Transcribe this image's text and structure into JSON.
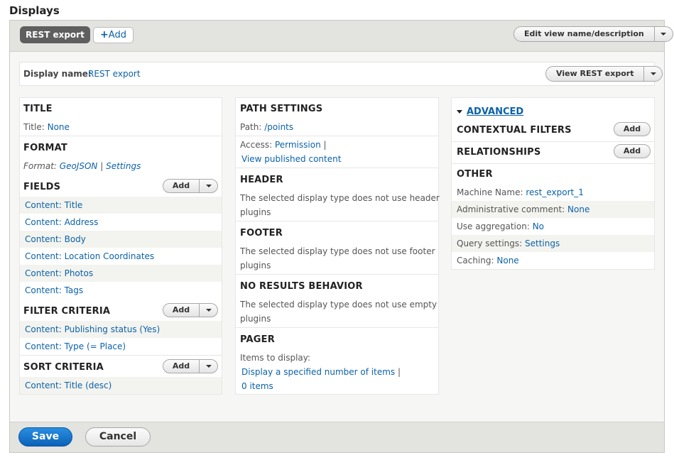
{
  "header": {
    "title": "Displays",
    "tab_rest": "REST export",
    "tab_add_plus": "+",
    "tab_add": "Add",
    "edit_view_button": "Edit view name/description"
  },
  "display": {
    "name_label": "Display name:",
    "name_value": "REST export",
    "view_button": "View REST export"
  },
  "left": {
    "title_head": "TITLE",
    "title_label": "Title:",
    "title_value": "None",
    "format_head": "FORMAT",
    "format_label": "Format:",
    "format_value": "GeoJSON",
    "format_sep": "|",
    "format_settings": "Settings",
    "fields_head": "FIELDS",
    "fields_add": "Add",
    "fields": [
      "Content: Title",
      "Content: Address",
      "Content: Body",
      "Content: Location Coordinates",
      "Content: Photos",
      "Content: Tags"
    ],
    "filter_head": "FILTER CRITERIA",
    "filter_add": "Add",
    "filters": [
      "Content: Publishing status (Yes)",
      "Content: Type (= Place)"
    ],
    "sort_head": "SORT CRITERIA",
    "sort_add": "Add",
    "sorts": [
      "Content: Title (desc)"
    ]
  },
  "middle": {
    "path_head": "PATH SETTINGS",
    "path_label": "Path:",
    "path_value": "/points",
    "access_label": "Access:",
    "access_value": "Permission",
    "access_sep": "|",
    "access_perm": "View published content",
    "header_head": "HEADER",
    "header_text_1": "The selected display type does not use header",
    "header_text_2": "plugins",
    "footer_head": "FOOTER",
    "footer_text_1": "The selected display type does not use footer",
    "footer_text_2": "plugins",
    "noresults_head": "NO RESULTS BEHAVIOR",
    "noresults_text_1": "The selected display type does not use empty",
    "noresults_text_2": "plugins",
    "pager_head": "PAGER",
    "pager_label": "Items to display:",
    "pager_value": "Display a specified number of items",
    "pager_sep": "|",
    "pager_items": "0 items"
  },
  "right": {
    "advanced": "ADVANCED",
    "contextual_head": "CONTEXTUAL FILTERS",
    "contextual_add": "Add",
    "relationships_head": "RELATIONSHIPS",
    "relationships_add": "Add",
    "other_head": "OTHER",
    "machine_label": "Machine Name:",
    "machine_value": "rest_export_1",
    "comment_label": "Administrative comment:",
    "comment_value": "None",
    "aggregation_label": "Use aggregation:",
    "aggregation_value": "No",
    "query_label": "Query settings:",
    "query_value": "Settings",
    "caching_label": "Caching:",
    "caching_value": "None"
  },
  "footer": {
    "save": "Save",
    "cancel": "Cancel"
  }
}
